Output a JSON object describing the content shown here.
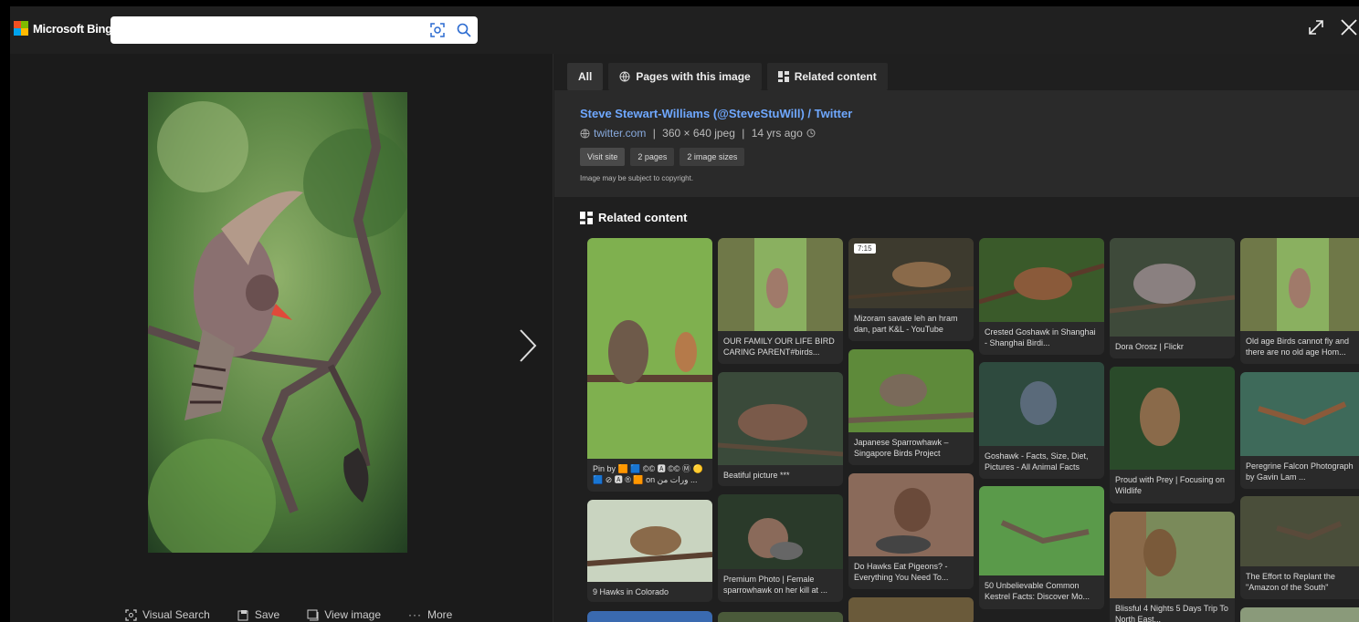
{
  "topbar": {
    "logo_text": "Microsoft Bing",
    "search_value": "",
    "search_placeholder": ""
  },
  "left_panel": {
    "actions": [
      {
        "label": "Visual Search"
      },
      {
        "label": "Save"
      },
      {
        "label": "View image"
      },
      {
        "label": "More"
      }
    ]
  },
  "tabs": [
    {
      "label": "All"
    },
    {
      "label": "Pages with this image"
    },
    {
      "label": "Related content"
    }
  ],
  "info": {
    "title": "Steve Stewart-Williams (@SteveStuWill) / Twitter",
    "domain": "twitter.com",
    "dims": "360 × 640 jpeg",
    "age": "14 yrs ago",
    "buttons": {
      "visit": "Visit site",
      "pages": "2 pages",
      "sizes": "2 image sizes"
    },
    "copyright": "Image may be subject to copyright."
  },
  "related_title": "Related content",
  "cards": [
    {
      "caption": "Pin by 🟧 🟦 ©© 🅰 ©© Ⓜ 🟡 🟦 ⊘ 🅰 ® 🟧 on ورات من ..."
    },
    {
      "caption": "9 Hawks in Colorado"
    },
    {
      "caption": "OUR FAMILY OUR LIFE BIRD CARING PARENT#birds..."
    },
    {
      "caption": "Beatiful picture ***"
    },
    {
      "caption": "Premium Photo | Female sparrowhawk on her kill at ..."
    },
    {
      "caption": "Mizoram savate leh an hram dan, part K&L - YouTube",
      "badge": "7:15"
    },
    {
      "caption": "Japanese Sparrowhawk – Singapore Birds Project"
    },
    {
      "caption": "Do Hawks Eat Pigeons? - Everything You Need To..."
    },
    {
      "caption": "Crested Goshawk in Shanghai - Shanghai Birdi..."
    },
    {
      "caption": "Goshawk - Facts, Size, Diet, Pictures - All Animal Facts"
    },
    {
      "caption": "50 Unbelievable Common Kestrel Facts: Discover Mo..."
    },
    {
      "caption": "Dora Orosz | Flickr"
    },
    {
      "caption": "Proud with Prey | Focusing on Wildlife"
    },
    {
      "caption": "Blissful 4 Nights 5 Days Trip To North East..."
    },
    {
      "caption": "Old age Birds cannot fly and there are no old age Hom..."
    },
    {
      "caption": "Peregrine Falcon Photograph by Gavin Lam ..."
    },
    {
      "caption": "The Effort to Replant the \"Amazon of the South\""
    }
  ]
}
